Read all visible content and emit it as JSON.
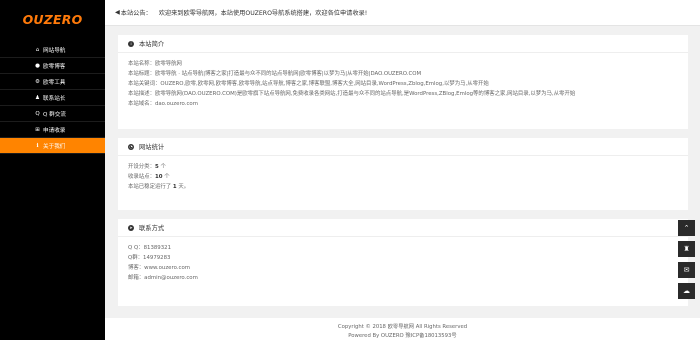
{
  "sidebar": {
    "logo": "OUZERO",
    "items": [
      {
        "icon": "home-icon",
        "glyph": "⌂",
        "label": "网站导航",
        "active": false
      },
      {
        "icon": "circle-icon",
        "glyph": "●",
        "label": "欧零博客",
        "active": false
      },
      {
        "icon": "gear-icon",
        "glyph": "⚙",
        "label": "欧零工具",
        "active": false
      },
      {
        "icon": "bell-icon",
        "glyph": "♟",
        "label": "联系站长",
        "active": false
      },
      {
        "icon": "qq-icon",
        "glyph": "Q",
        "label": "Q 群交流",
        "active": false
      },
      {
        "icon": "plus-square-icon",
        "glyph": "⊞",
        "label": "申请收录",
        "active": false
      },
      {
        "icon": "info-icon",
        "glyph": "ℹ",
        "label": "关于我们",
        "active": true
      }
    ]
  },
  "topbar": {
    "icon": "megaphone-icon",
    "label": "本站公告：",
    "text": "欢迎来到欧零导航网，本站使用OUZERO导航系统搭建，欢迎各位申请收录!"
  },
  "intro": {
    "icon": "info-icon",
    "title": "本站简介",
    "rows": [
      "本站名称：欧零导航网",
      "本站标题：欧零导航 · 站点导航|博客之家|打造最与众不同的站点导航网|欧零博客|以梦为马|从零开始|DAO.OUZERO.COM",
      "本站关键词：OUZERO,欧零,欧零网,欧零博客,欧零导航,站点导航,博客之家,博客联盟,博客大全,网站目录,WordPress,Zblog,Emlog,以梦为马,从零开始",
      "本站描述：欧零导航网(DAO.OUZERO.COM)是欧零旗下站点导航网,免费收录各类网站,打造最与众不同的站点导航,是WordPress,ZBlog,Emlog等的博客之家,网站目录,以梦为马,从零开始",
      "本站域名：dao.ouzero.com"
    ]
  },
  "stats": {
    "icon": "pie-chart-icon",
    "title": "网站统计",
    "rows": [
      {
        "label": "开设分类：",
        "value": "5",
        "suffix": " 个"
      },
      {
        "label": "收录站点：",
        "value": "10",
        "suffix": " 个"
      },
      {
        "label": "本站已稳定运行了 ",
        "value": "1",
        "suffix": " 天。"
      }
    ]
  },
  "contact": {
    "icon": "paper-plane-icon",
    "title": "联系方式",
    "rows": [
      "Q Q：81389321",
      "Q群：14979283",
      "博客：www.ouzero.com",
      "邮箱：admin@ouzero.com"
    ]
  },
  "footer": {
    "copyright": "Copyright © 2018 欧零导航网  All Rights Reserved",
    "powered": "Powered By OUZERO   豫ICP备18013593号"
  },
  "float_buttons": [
    {
      "icon": "chevron-up-icon",
      "glyph": "⌃"
    },
    {
      "icon": "qq-icon",
      "glyph": "♜"
    },
    {
      "icon": "envelope-icon",
      "glyph": "✉"
    },
    {
      "icon": "wechat-icon",
      "glyph": "☁"
    }
  ]
}
